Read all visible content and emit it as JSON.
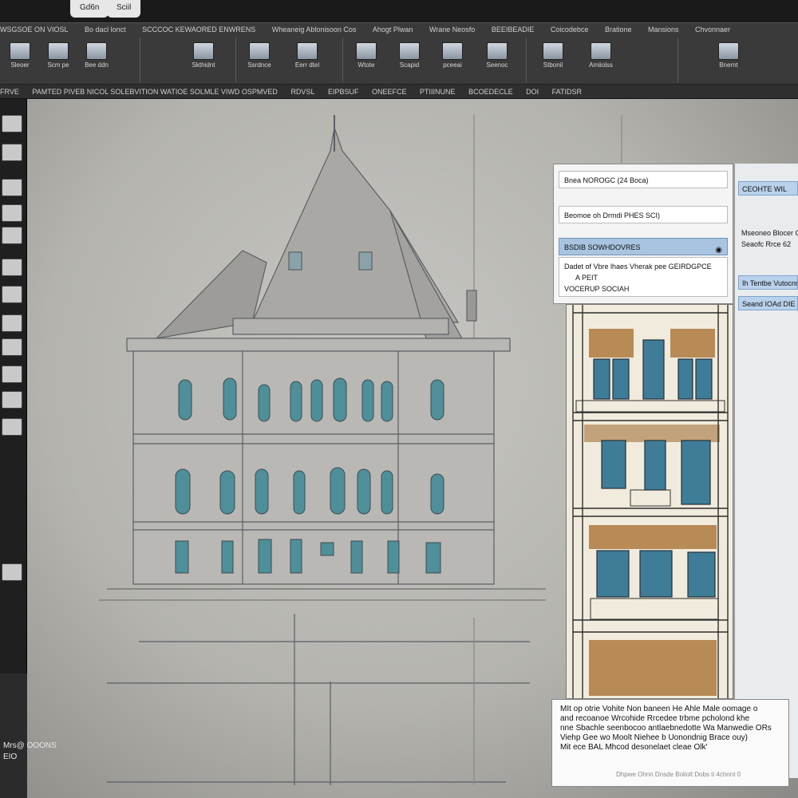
{
  "title_tabs": [
    "Gd6n",
    "Sciil"
  ],
  "ribbon": {
    "menu": [
      "WSGSOE ON VIOSL",
      "Bo dacl lonct",
      "SCCCOC KEWAORED ENWRENS",
      "Wheaneig Ablonisoon Cos",
      "Ahogt Plwan",
      "Wrane Neosfo",
      "BEEIBEADIE",
      "Coicodebce",
      "Bratione",
      "Mansions",
      "Chvonnaer"
    ],
    "buttons": [
      "Sleoer",
      "Scm pe",
      "Bee ddn",
      "Skthidnt",
      "Ssrdnce",
      "Eerr dtel",
      "Wtote",
      "Scapid",
      "pceeai",
      "Seenoc",
      "Stbonil",
      "Amiiolss",
      "Bnernt"
    ]
  },
  "command_bar": {
    "items": [
      "FRVE",
      "PAMTED PIVEB NICOL SOLEBVITION WATIOE SOLMLE VIWD OSPMVED",
      "RDVSL",
      "EIPBSUF",
      "ONEEFCE",
      "PTIIINUNE",
      "BCOEDECLE",
      "DOI",
      "FATIDSR"
    ]
  },
  "properties": {
    "rows": [
      {
        "label": "Bnea NOROGC (24 Boca)",
        "highlight": false
      },
      {
        "label": "Beomoe oh Drmdi PHES SCI)",
        "highlight": false
      },
      {
        "label": "BSDIB SOWHDOVRES",
        "highlight": true
      },
      {
        "label": "Dadet of Vbre lhaes Vherak pee GEIRDGPCE",
        "highlight": false
      },
      {
        "label": "A PEIT",
        "highlight": false
      },
      {
        "label": "VOCERUP SOCIAH",
        "highlight": false
      }
    ]
  },
  "right_panel": {
    "rows": [
      "CEOHTE WIL",
      "Mseoneo Blocer Co",
      "Seaofc Rrce 62",
      "Ih Tentbe Vutocnn",
      "Seand IOAd DIE"
    ]
  },
  "notes": {
    "lines": [
      "MIt op otrie Vohite Non baneen He Ahle Male oomage o",
      "and recoanoe Wrcohide Rrcedee trbme pcholond khe",
      "nne Sbachle seenbocoo antlaebnedotte Wa Manwedie ORs",
      "Viehp Gee wo Moolt Niehee b Uonondnig Brace ouy)",
      "Mit ece BAL Mhcod desonelaet cleae Olk'"
    ],
    "footer": "Dhpwe Ohnn Dnsde Boliolt Dobs ti 4chnnt 0"
  },
  "status": {
    "line1": "Mrs@ OOONS",
    "line2": "EIO"
  }
}
